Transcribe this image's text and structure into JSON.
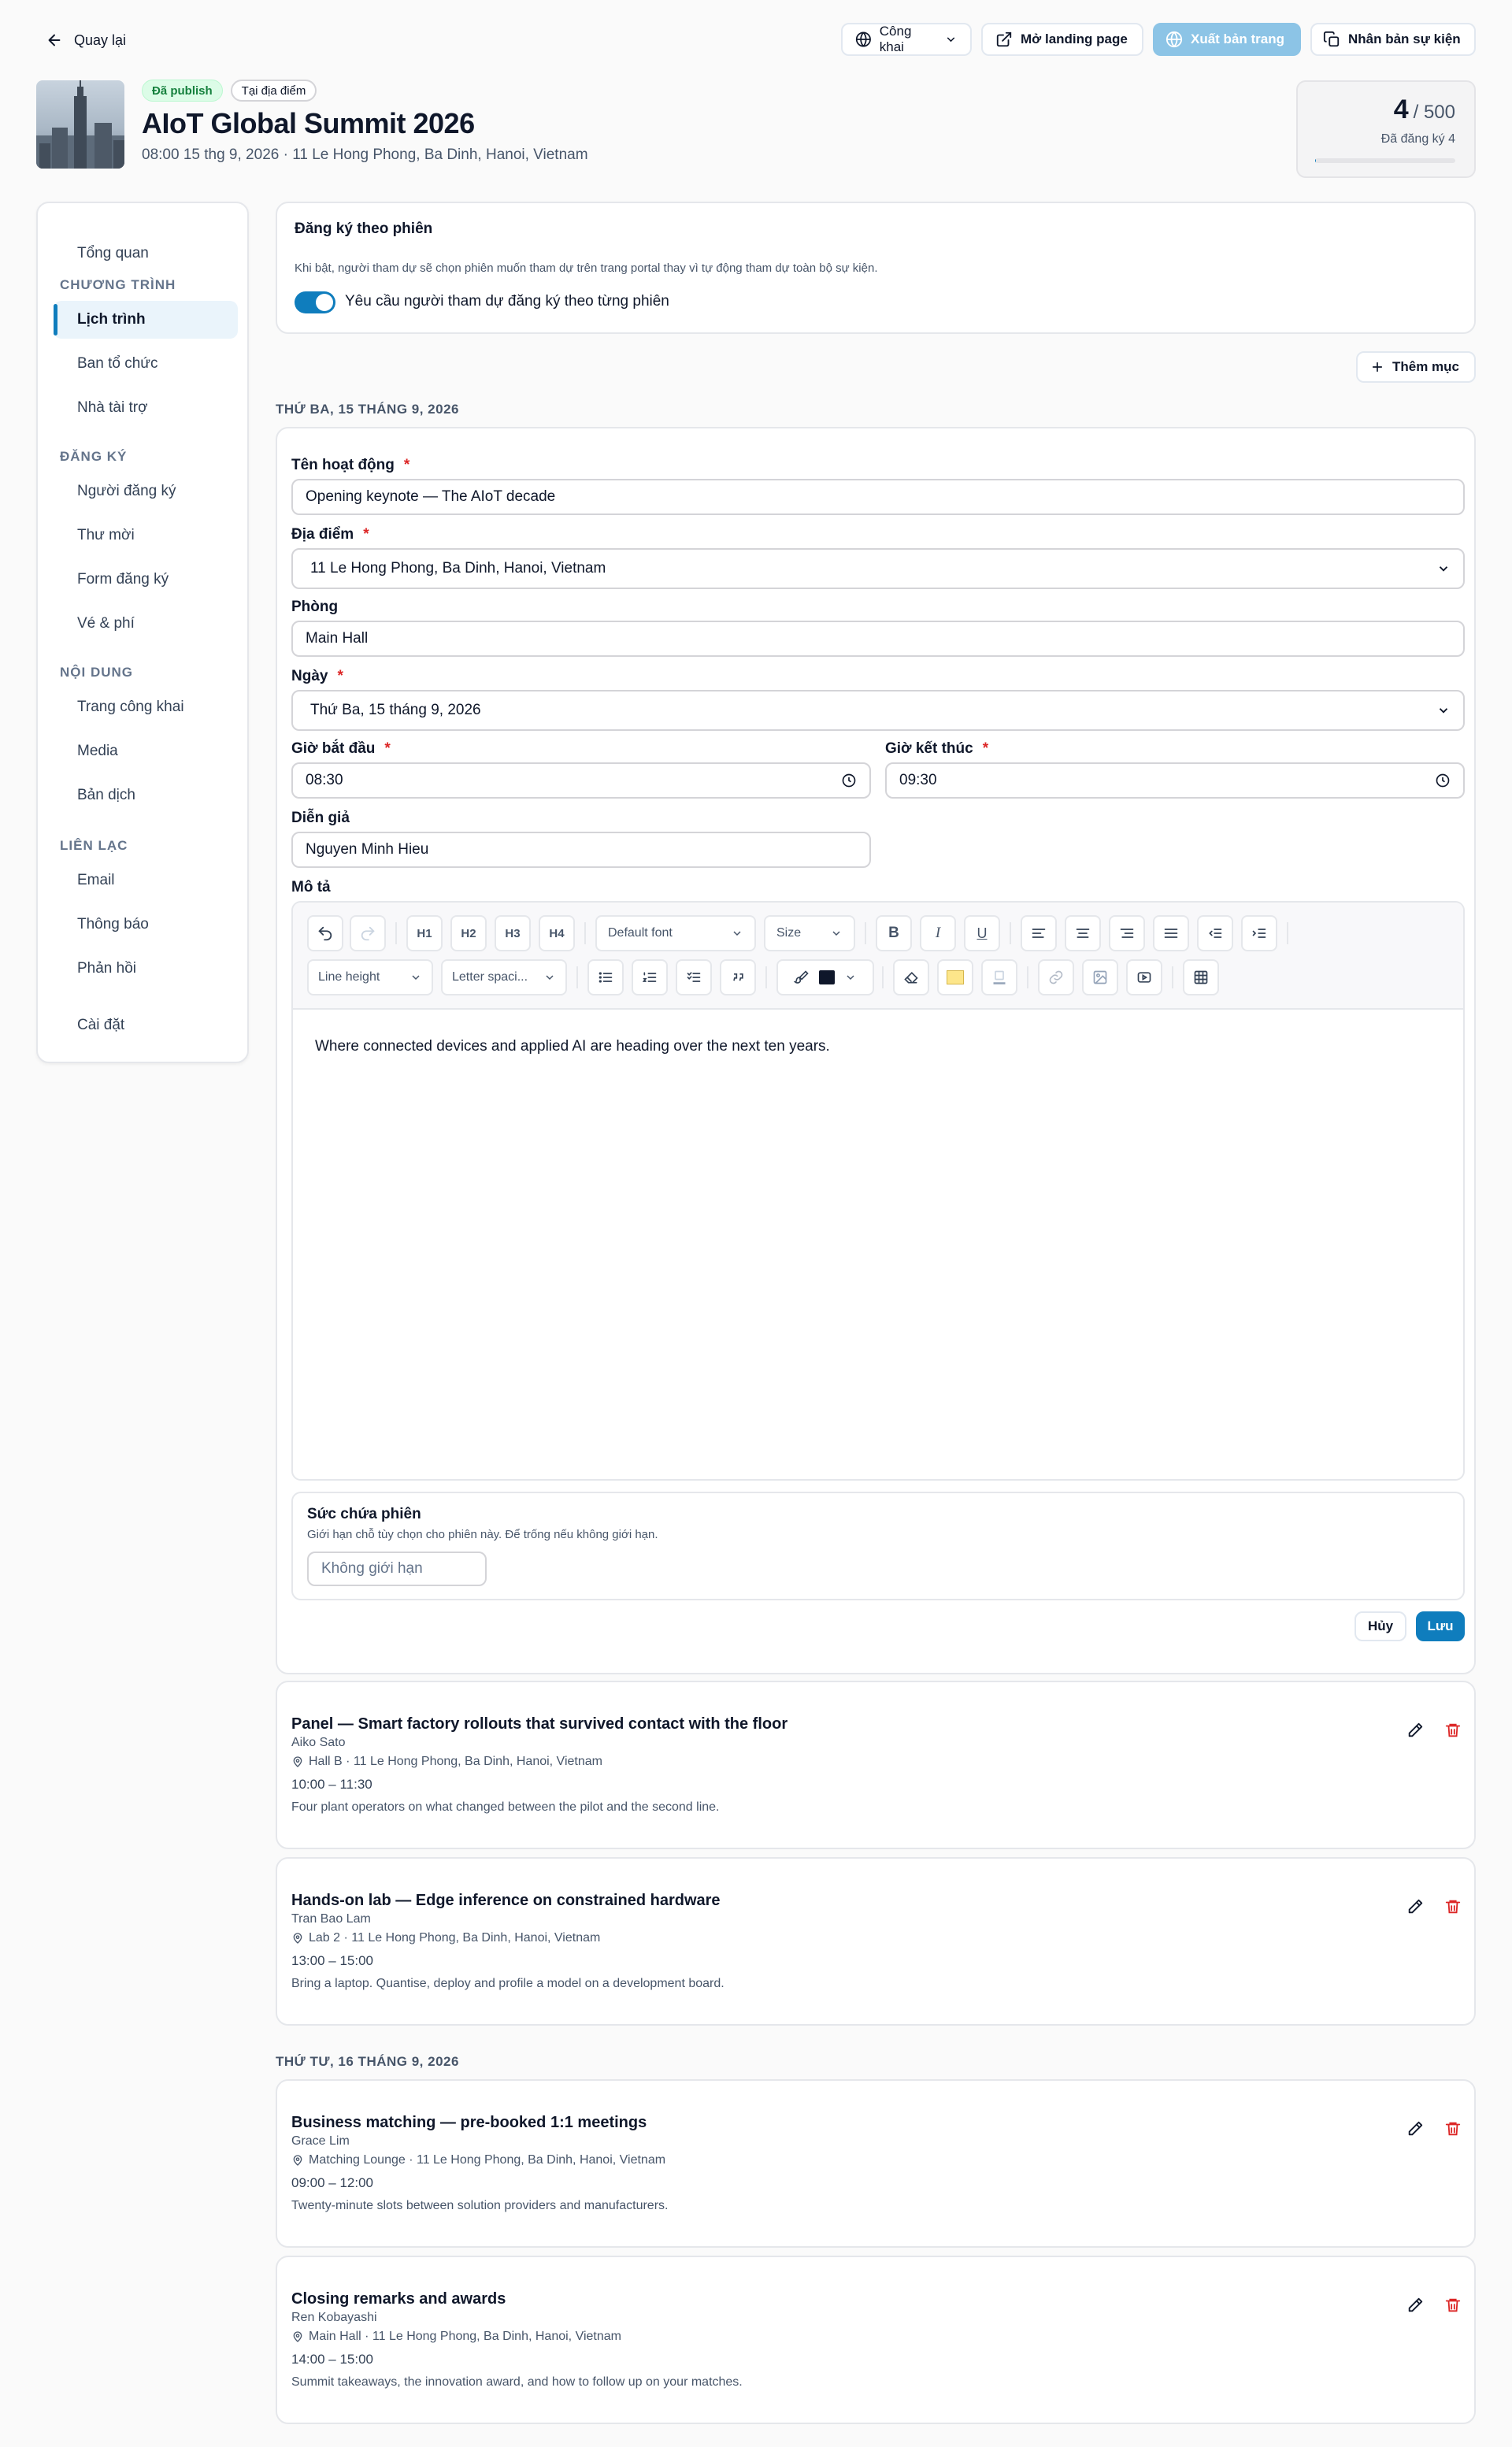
{
  "header": {
    "back_label": "Quay lại",
    "visibility_label": "Công khai",
    "open_landing_label": "Mở landing page",
    "publish_label": "Xuất bản trang",
    "duplicate_label": "Nhân bản sự kiện"
  },
  "event": {
    "badge_published": "Đã publish",
    "badge_onsite": "Tại địa điểm",
    "title": "AIoT Global Summit 2026",
    "subtitle": "08:00 15 thg 9, 2026 · 11 Le Hong Phong, Ba Dinh, Hanoi, Vietnam",
    "registered_count": "4",
    "capacity": "/ 500",
    "registered_label": "Đã đăng ký 4",
    "registered_fraction": 0.008
  },
  "sidebar": {
    "overview": "Tổng quan",
    "groups": [
      {
        "heading": "CHƯƠNG TRÌNH",
        "items": [
          "Lịch trình",
          "Ban tổ chức",
          "Nhà tài trợ"
        ]
      },
      {
        "heading": "ĐĂNG KÝ",
        "items": [
          "Người đăng ký",
          "Thư mời",
          "Form đăng ký",
          "Vé & phí"
        ]
      },
      {
        "heading": "NỘI DUNG",
        "items": [
          "Trang công khai",
          "Media",
          "Bản dịch"
        ]
      },
      {
        "heading": "LIÊN LẠC",
        "items": [
          "Email",
          "Thông báo",
          "Phản hồi"
        ]
      }
    ],
    "settings": "Cài đặt",
    "active": "Lịch trình"
  },
  "session_reg": {
    "title": "Đăng ký theo phiên",
    "description": "Khi bật, người tham dự sẽ chọn phiên muốn tham dự trên trang portal thay vì tự động tham dự toàn bộ sự kiện.",
    "toggle_label": "Yêu cầu người tham dự đăng ký theo từng phiên",
    "toggle_on": true
  },
  "add_item_label": "Thêm mục",
  "day1": {
    "heading": "THỨ BA, 15 THÁNG 9, 2026"
  },
  "form": {
    "name_label": "Tên hoạt động",
    "name_value": "Opening keynote — The AIoT decade",
    "location_label": "Địa điểm",
    "location_value": "11 Le Hong Phong, Ba Dinh, Hanoi, Vietnam",
    "room_label": "Phòng",
    "room_value": "Main Hall",
    "date_label": "Ngày",
    "date_value": "Thứ Ba, 15 tháng 9, 2026",
    "start_label": "Giờ bắt đầu",
    "start_value": "08:30",
    "end_label": "Giờ kết thúc",
    "end_value": "09:30",
    "speaker_label": "Diễn giả",
    "speaker_value": "Nguyen Minh Hieu",
    "desc_label": "Mô tả",
    "desc_value": "Where connected devices and applied AI are heading over the next ten years.",
    "toolbar": {
      "font": "Default font",
      "size": "Size",
      "line_height": "Line height",
      "letter_spacing": "Letter spaci...",
      "h1": "H1",
      "h2": "H2",
      "h3": "H3",
      "h4": "H4",
      "bold": "B",
      "italic": "I",
      "underline": "U"
    },
    "capacity_title": "Sức chứa phiên",
    "capacity_hint": "Giới hạn chỗ tùy chọn cho phiên này. Để trống nếu không giới hạn.",
    "capacity_placeholder": "Không giới hạn",
    "cancel_label": "Hủy",
    "save_label": "Lưu"
  },
  "day1_activities": [
    {
      "title": "Panel — Smart factory rollouts that survived contact with the floor",
      "speaker": "Aiko Sato",
      "location": "Hall B · 11 Le Hong Phong, Ba Dinh, Hanoi, Vietnam",
      "time": "10:00 – 11:30",
      "desc": "Four plant operators on what changed between the pilot and the second line."
    },
    {
      "title": "Hands-on lab — Edge inference on constrained hardware",
      "speaker": "Tran Bao Lam",
      "location": "Lab 2 · 11 Le Hong Phong, Ba Dinh, Hanoi, Vietnam",
      "time": "13:00 – 15:00",
      "desc": "Bring a laptop. Quantise, deploy and profile a model on a development board."
    }
  ],
  "day2": {
    "heading": "THỨ TƯ, 16 THÁNG 9, 2026"
  },
  "day2_activities": [
    {
      "title": "Business matching — pre-booked 1:1 meetings",
      "speaker": "Grace Lim",
      "location": "Matching Lounge · 11 Le Hong Phong, Ba Dinh, Hanoi, Vietnam",
      "time": "09:00 – 12:00",
      "desc": "Twenty-minute slots between solution providers and manufacturers."
    },
    {
      "title": "Closing remarks and awards",
      "speaker": "Ren Kobayashi",
      "location": "Main Hall · 11 Le Hong Phong, Ba Dinh, Hanoi, Vietnam",
      "time": "14:00 – 15:00",
      "desc": "Summit takeaways, the innovation award, and how to follow up on your matches."
    }
  ],
  "colors": {
    "accent": "#0f7dbd",
    "published_bg": "#dcfce7",
    "published_fg": "#15803d",
    "danger": "#dc2626"
  }
}
